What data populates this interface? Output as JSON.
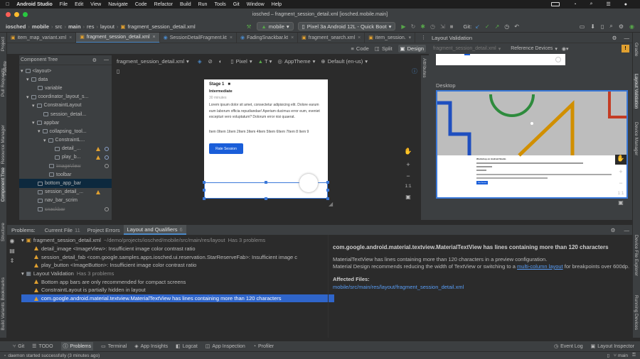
{
  "menubar": {
    "apple": "",
    "app": "Android Studio",
    "items": [
      "File",
      "Edit",
      "View",
      "Navigate",
      "Code",
      "Refactor",
      "Build",
      "Run",
      "Tools",
      "Git",
      "Window",
      "Help"
    ]
  },
  "titlebar": {
    "title": "iosched – fragment_session_detail.xml [iosched.mobile.main]"
  },
  "navbar": {
    "crumbs": [
      "iosched",
      "mobile",
      "src",
      "main",
      "res",
      "layout"
    ],
    "file": "fragment_session_detail.xml",
    "module": "mobile",
    "device": "Pixel 3a Android 12L - Quick Boot",
    "git_label": "Git:"
  },
  "tabs": [
    {
      "label": "item_map_variant.xml",
      "active": false
    },
    {
      "label": "fragment_session_detail.xml",
      "active": true
    },
    {
      "label": "SessionDetailFragment.kt",
      "active": false
    },
    {
      "label": "FadingSnackbar.kt",
      "active": false
    },
    {
      "label": "fragment_search.xml",
      "active": false
    },
    {
      "label": "item_session.",
      "active": false
    }
  ],
  "view_modes": {
    "code": "Code",
    "split": "Split",
    "design": "Design"
  },
  "toolbar": {
    "file": "fragment_session_detail.xml",
    "device": "Pixel",
    "theme": "AppTheme",
    "locale": "Default (en-us)",
    "api": "T"
  },
  "left_tools": [
    "Project",
    "Resource Manager",
    "Pull Requests",
    "Palette",
    "Component Tree",
    "Structure",
    "Bookmarks",
    "Build Variants"
  ],
  "right_tools": [
    "Gradle",
    "Layout Validation",
    "Device Manager",
    "Device File Explorer",
    "Running Devices"
  ],
  "attributes_label": "Attributes",
  "component_tree": {
    "title": "Component Tree",
    "nodes": [
      {
        "label": "<layout>",
        "depth": 0
      },
      {
        "label": "data",
        "depth": 1
      },
      {
        "label": "variable",
        "depth": 2
      },
      {
        "label": "coordinator_layout_s...",
        "depth": 1
      },
      {
        "label": "ConstraintLayout",
        "depth": 2
      },
      {
        "label": "session_detail...",
        "depth": 3
      },
      {
        "label": "appbar",
        "depth": 2
      },
      {
        "label": "collapsing_tool...",
        "depth": 3
      },
      {
        "label": "ConstraintL...",
        "depth": 4
      },
      {
        "label": "detail_...",
        "depth": 5
      },
      {
        "label": "play_b...",
        "depth": 5
      },
      {
        "label": "ImageView",
        "depth": 4
      },
      {
        "label": "toolbar",
        "depth": 4
      },
      {
        "label": "bottom_app_bar",
        "depth": 2
      },
      {
        "label": "session_detail_...",
        "depth": 2
      },
      {
        "label": "nav_bar_scrim",
        "depth": 2
      },
      {
        "label": "snackbar",
        "depth": 2
      }
    ]
  },
  "preview": {
    "stage": "Stage 1",
    "level": "Intermediate",
    "duration": "30 minutes",
    "description": "Lorem ipsum dolor sit amet, consectetur adipisicing elit. Dolore earum eum laborum officia repudiandae! Aperiam ducimus error eum, eveniet excepturi vero voluptatum? Dolorum error nisi quaerat.",
    "items": "Item 0Item 1Item 2Item 3Item 4Item 5Item 6Item 7Item 8 Item 9",
    "button": "Rate Session"
  },
  "zoom": {
    "ratio": "1:1"
  },
  "validation": {
    "title": "Layout Validation",
    "file": "fragment_session_detail.xml",
    "dropdown": "Reference Devices",
    "desktop_label": "Desktop",
    "mini_title": "Workshop on Android Studio",
    "mini_button": "Rate Session",
    "ratio": "1:1"
  },
  "problems": {
    "label": "Problems:",
    "tabs": [
      {
        "label": "Current File",
        "count": "11",
        "active": false
      },
      {
        "label": "Project Errors",
        "count": "",
        "active": false
      },
      {
        "label": "Layout and Qualifiers",
        "count": "6",
        "active": true
      }
    ],
    "groups": [
      {
        "title": "fragment_session_detail.xml",
        "path": "~/demo/projects/iosched/mobile/src/main/res/layout",
        "count": "Has 3 problems",
        "items": [
          "detail_image <ImageView>: Insufficient image color contrast ratio",
          "session_detail_fab <com.google.samples.apps.iosched.ui.reservation.StarReserveFab>: Insufficient image c",
          "play_button <ImageButton>: Insufficient image color contrast ratio"
        ]
      },
      {
        "title": "Layout Validation",
        "path": "",
        "count": "Has 3 problems",
        "items": [
          "Bottom app bars are only recommended for compact screens",
          "ConstraintLayout is partially hidden in layout",
          "com.google.android.material.textview.MaterialTextView has lines containing more than 120 characters"
        ]
      }
    ]
  },
  "detail": {
    "title": "com.google.android.material.textview.MaterialTextView has lines containing more than 120 characters",
    "line1": "MaterialTextView has lines containing more than 120 characters in a preview configuration.",
    "line2_a": "Material Design recommends reducing the width of TextView or switching to a",
    "line2_link": "multi-column layout",
    "line2_b": "for breakpoints over 600dp.",
    "affected_label": "Affected Files:",
    "affected_file": "mobile/src/main/res/layout/fragment_session_detail.xml"
  },
  "bottom_tools": [
    "Git",
    "TODO",
    "Problems",
    "Terminal",
    "App Insights",
    "Logcat",
    "App Inspection",
    "Profiler"
  ],
  "bottom_right": [
    "Event Log",
    "Layout Inspector"
  ],
  "status": {
    "message": "daemon started successfully (3 minutes ago)",
    "branch": "main"
  },
  "colors": {
    "accent": "#4a88c7",
    "selection": "#2f65ca",
    "warning": "#e0a030",
    "button": "#1a5ed9",
    "link": "#589df6"
  }
}
